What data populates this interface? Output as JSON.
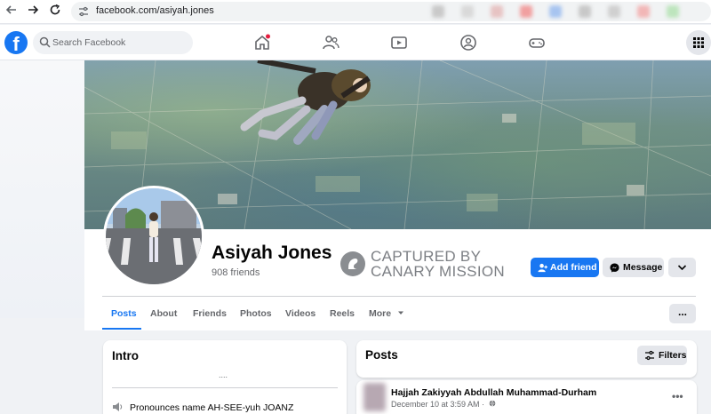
{
  "browser": {
    "url": "facebook.com/asiyah.jones",
    "back_icon": "arrow-left-icon",
    "forward_icon": "arrow-right-icon",
    "reload_icon": "reload-icon",
    "extension_colors": [
      "#c9c9c9",
      "#d9d9d9",
      "#e7c3c3",
      "#f1a0a0",
      "#a7c4f0",
      "#c8c8c8",
      "#d0d0d0",
      "#f2b6b6",
      "#bde5bd"
    ]
  },
  "header": {
    "logo": "f",
    "search_placeholder": "Search Facebook",
    "nav_icons": [
      "home-icon",
      "friends-icon",
      "watch-icon",
      "groups-icon",
      "gaming-icon"
    ],
    "apps_icon": "grid-menu-icon",
    "accent": "#1877f2"
  },
  "profile": {
    "name": "Asiyah Jones",
    "friends": "908 friends",
    "stamp_line1": "CAPTURED BY",
    "stamp_line2": "CANARY MISSION",
    "add_friend": "Add friend",
    "message": "Message"
  },
  "tabs": [
    {
      "label": "Posts",
      "active": true
    },
    {
      "label": "About"
    },
    {
      "label": "Friends"
    },
    {
      "label": "Photos"
    },
    {
      "label": "Videos"
    },
    {
      "label": "Reels"
    },
    {
      "label": "More"
    }
  ],
  "more_button": "...",
  "intro": {
    "title": "Intro",
    "ellipsis": "....",
    "pronounce": "Pronounces name AH-SEE-yuh JOANZ"
  },
  "posts": {
    "title": "Posts",
    "filters": "Filters",
    "post": {
      "author": "Hajjah Zakiyyah Abdullah Muhammad-Durham",
      "date": "December 10 at 3:59 AM ·",
      "more": "•••"
    }
  }
}
